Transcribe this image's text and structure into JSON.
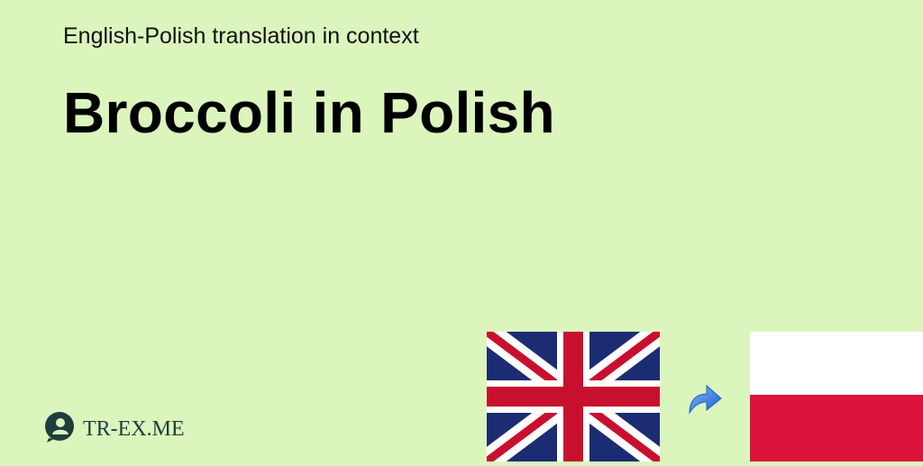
{
  "header": {
    "subtitle": "English-Polish translation in context",
    "title": "Broccoli in Polish"
  },
  "logo": {
    "text": "TR-EX.ME",
    "icon": "speech-bubble-person-icon"
  },
  "flags": {
    "source": "united-kingdom-flag",
    "target": "poland-flag",
    "arrow_icon": "arrow-right-icon"
  },
  "colors": {
    "background": "#dcf5bd",
    "uk_blue": "#1b2c73",
    "uk_red": "#c8102e",
    "pl_white": "#ffffff",
    "pl_red": "#dc143c",
    "arrow_blue": "#2b7be0"
  }
}
